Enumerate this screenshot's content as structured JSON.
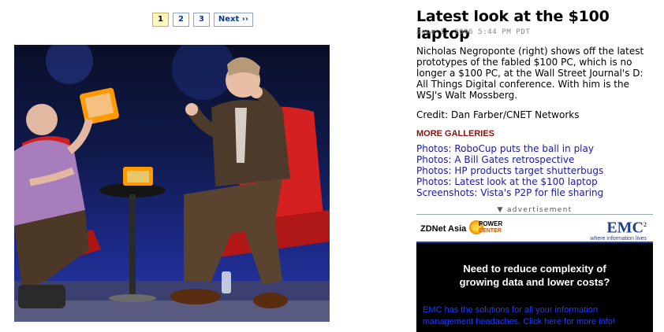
{
  "pager": {
    "pages": [
      "1",
      "2",
      "3"
    ],
    "current": "1",
    "next_label": "Next ››"
  },
  "photo": {
    "description_icon": "photo-image"
  },
  "article": {
    "title": "Latest look at the $100 laptop",
    "date": "June 1, 2006 5:44 PM PDT",
    "caption": "Nicholas Negroponte (right) shows off the latest prototypes of the fabled $100 PC, which is no longer a $100 PC, at the Wall Street Journal's D: All Things Digital conference. With him is the WSJ's Walt Mossberg.",
    "credit": "Credit: Dan Farber/CNET Networks"
  },
  "galleries": {
    "heading": "MORE GALLERIES",
    "items": [
      "Photos: RoboCup puts the ball in play",
      "Photos: A Bill Gates retrospective",
      "Photos: HP products target shutterbugs",
      "Photos: Latest look at the $100 laptop",
      "Screenshots: Vista's P2P for file sharing"
    ]
  },
  "ad": {
    "label": "advertisement",
    "zdnet": "ZDNet Asia",
    "power_top": "POWER",
    "power_bottom": "CENTER",
    "emc_logo": "EMC",
    "emc_sup": "2",
    "emc_tagline": "where information lives",
    "headline_1": "Need to reduce complexity of",
    "headline_2": "growing data and lower costs?",
    "footer_1": "EMC has the solutions for all your information",
    "footer_2": "management headaches. Click here for more info!"
  },
  "colors": {
    "link": "#1a1a9e",
    "heading_red": "#8b1010",
    "pager_current_bg": "#fff6bf"
  }
}
